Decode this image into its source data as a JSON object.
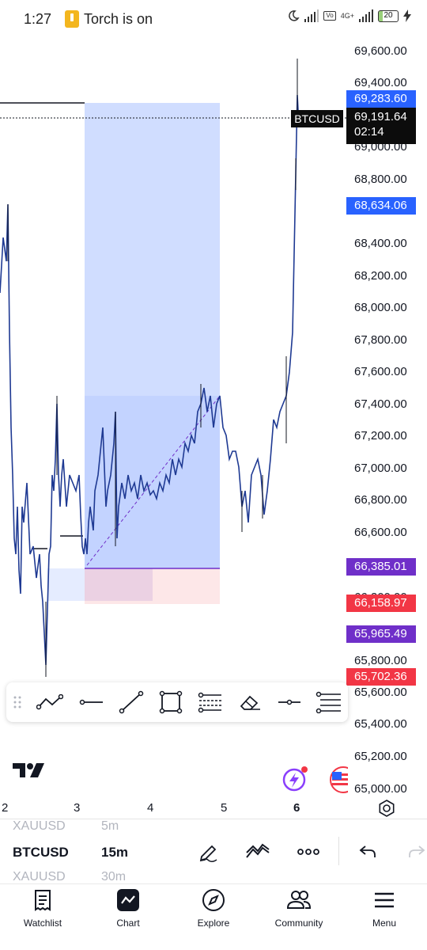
{
  "status_bar": {
    "time": "1:27",
    "torch_text": "Torch is on",
    "network": "4G+",
    "battery": "20"
  },
  "chart": {
    "symbol": "BTCUSD",
    "last_price": "69,191.64",
    "countdown": "02:14",
    "price_scale": [
      "69,600.00",
      "69,400.00",
      "69,000.00",
      "68,800.00",
      "68,400.00",
      "68,200.00",
      "68,000.00",
      "67,800.00",
      "67,600.00",
      "67,400.00",
      "67,200.00",
      "67,000.00",
      "66,800.00",
      "66,600.00",
      "66,200.00",
      "65,800.00",
      "65,600.00",
      "65,400.00",
      "65,200.00",
      "65,000.00"
    ],
    "tags": {
      "target_high": "69,283.60",
      "level_blue": "68,634.06",
      "entry": "66,385.01",
      "stop": "66,158.97",
      "level_purple": "65,965.49",
      "low": "65,702.36"
    },
    "x_axis": [
      "2",
      "3",
      "4",
      "5",
      "6"
    ],
    "colors": {
      "candles": "#1f3a93",
      "long_zone": "#2962ff",
      "entry_line": "#6f2fc9",
      "stop_zone": "#f23645"
    }
  },
  "drawing_toolbar": {
    "tools": [
      "drag-handle-icon",
      "trend-line-multi-icon",
      "horizontal-ray-icon",
      "trend-line-icon",
      "rectangle-icon",
      "fib-retracement-icon",
      "eraser-icon",
      "horizontal-line-icon",
      "more-tools-icon"
    ]
  },
  "symbol_strip": {
    "prev_symbol": "XAUUSD",
    "prev_interval": "5m",
    "current_symbol": "BTCUSD",
    "current_interval": "15m",
    "next_symbol": "XAUUSD",
    "next_interval": "30m"
  },
  "bottom_nav": {
    "items": [
      {
        "label": "Watchlist",
        "icon": "watchlist-icon"
      },
      {
        "label": "Chart",
        "icon": "chart-icon"
      },
      {
        "label": "Explore",
        "icon": "compass-icon"
      },
      {
        "label": "Community",
        "icon": "community-icon"
      },
      {
        "label": "Menu",
        "icon": "menu-icon"
      }
    ]
  }
}
